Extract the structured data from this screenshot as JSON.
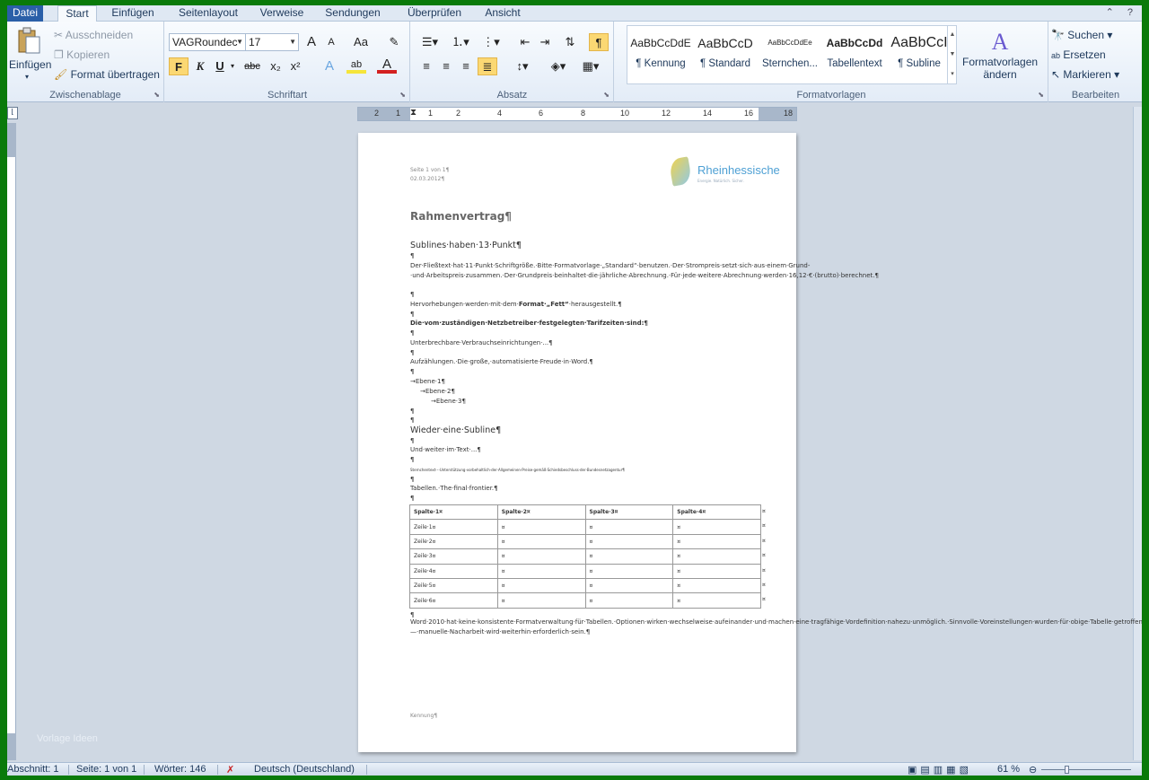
{
  "tabs": [
    "Datei",
    "Start",
    "Einfügen",
    "Seitenlayout",
    "Verweise",
    "Sendungen",
    "Überprüfen",
    "Ansicht"
  ],
  "clipboard": {
    "paste": "Einfügen",
    "cut": "Ausschneiden",
    "copy": "Kopieren",
    "format_painter": "Format übertragen",
    "label": "Zwischenablage"
  },
  "font": {
    "name": "VAGRoundec",
    "size": "17",
    "label": "Schriftart",
    "bold": "F",
    "italic": "K",
    "underline": "U",
    "strike": "abc",
    "sub": "x₂",
    "sup": "x²",
    "grow": "A",
    "shrink": "A",
    "case": "Aa",
    "color_a": "A",
    "hl": "ab"
  },
  "paragraph": {
    "label": "Absatz",
    "pilcrow": "¶"
  },
  "styles": {
    "label": "Formatvorlagen",
    "items": [
      {
        "sample": "AaBbCcDdE",
        "name": "¶ Kennung"
      },
      {
        "sample": "AaBbCcD",
        "name": "¶ Standard"
      },
      {
        "sample": "AaBbCcDdEe",
        "name": "Sternchen..."
      },
      {
        "sample": "AaBbCcDd",
        "name": "Tabellentext"
      },
      {
        "sample": "AaBbCcI",
        "name": "¶ Subline"
      }
    ],
    "change_line1": "Formatvorlagen",
    "change_line2": "ändern"
  },
  "editing": {
    "label": "Bearbeiten",
    "find": "Suchen",
    "replace": "Ersetzen",
    "select": "Markieren"
  },
  "ruler_numbers": [
    "2",
    "1",
    "1",
    "2",
    "4",
    "6",
    "8",
    "10",
    "12",
    "14",
    "16",
    "18"
  ],
  "document": {
    "header_page": "Seite 1 von 1¶",
    "header_date": "02.03.2012¶",
    "logo_name": "Rheinhessische",
    "logo_tag": "Energie. Natürlich. Sicher.",
    "title": "Rahmenvertrag¶",
    "subline1": "Sublines·haben·13·Punkt¶",
    "pil": "¶",
    "body1": "Der·Fließtext·hat·11·Punkt·Schriftgröße.·Bitte·Formatvorlage·„Standard“·benutzen.·Der·Strompreis·setzt·sich·aus·einem·Grund-·und·Arbeitspreis·zusammen.·Der·Grundpreis·beinhaltet·die·jährliche·Abrechnung.·Für·jede·weitere·Abrechnung·werden·16,12·€·(brutto)·berechnet.¶",
    "body2_a": "Hervorhebungen·werden·mit·dem·",
    "body2_b": "Format·„Fett“",
    "body2_c": "·herausgestellt.¶",
    "body3": "Die·vom·zuständigen·Netzbetreiber·festgelegten·Tarifzeiten·sind:¶",
    "body4": "Unterbrechbare·Verbrauchseinrichtungen·...¶",
    "body5": "Aufzählungen.·Die·große,·automatisierte·Freude·in·Word.¶",
    "level1": "→Ebene·1¶",
    "level2": "→Ebene·2¶",
    "level3": "→Ebene·3¶",
    "subline2": "Wieder·eine·Subline¶",
    "body6": "Und·weiter·im·Text·...¶",
    "tiny": "Sternchentext·–·Unterstützung·vorbehaltlich·der·Allgemeinen·Preise·gemäß·Schiedsbeschluss·der·Bundesnetzagentur¶",
    "body7": "Tabellen.·The·final·frontier.¶",
    "table_header": [
      "Spalte·1¤",
      "Spalte·2¤",
      "Spalte·3¤",
      "Spalte·4¤"
    ],
    "table_rows": [
      [
        "Zeile·1¤",
        "¤",
        "¤",
        "¤"
      ],
      [
        "Zeile·2¤",
        "¤",
        "¤",
        "¤"
      ],
      [
        "Zeile·3¤",
        "¤",
        "¤",
        "¤"
      ],
      [
        "Zeile·4¤",
        "¤",
        "¤",
        "¤"
      ],
      [
        "Zeile·5¤",
        "¤",
        "¤",
        "¤"
      ],
      [
        "Zeile·6¤",
        "¤",
        "¤",
        "¤"
      ]
    ],
    "cellmark": "¤",
    "body8": "Word·2010·hat·keine·konsistente·Formatverwaltung·für·Tabellen.·Optionen·wirken·wechselweise·aufeinander·und·machen·eine·tragfähige·Vordefinition·nahezu·unmöglich.·Sinnvolle·Voreinstellungen·wurden·für·obige·Tabelle·getroffen·—·manuelle·Nacharbeit·wird·weiterhin·erforderlich·sein.¶",
    "footer": "Kennung¶"
  },
  "watermark": "Vorlage Ideen",
  "status": {
    "section": "Abschnitt: 1",
    "page": "Seite: 1 von 1",
    "words": "Wörter: 146",
    "language": "Deutsch (Deutschland)",
    "zoom": "61 %"
  },
  "colors": {
    "frame": "#0a7a0a",
    "file_tab": "#2a5fa8",
    "highlight": "#fbd873"
  }
}
